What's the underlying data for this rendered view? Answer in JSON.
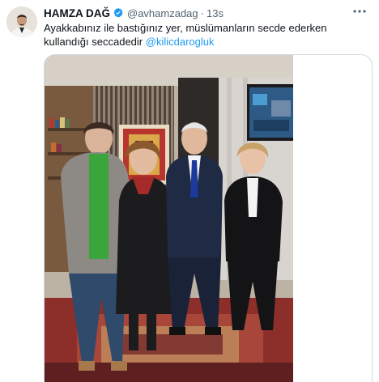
{
  "tweet": {
    "display_name": "HAMZA DAĞ",
    "handle": "@avhamzadag",
    "separator": "·",
    "time": "13s",
    "text_before": "Ayakkabınız ile bastığınız yer, müslümanların secde ederken kullandığı seccadedir ",
    "mention": "@kilicdarogluk"
  },
  "icons": {
    "verified": "verified-badge-icon",
    "more": "more-options-icon"
  },
  "colors": {
    "accent": "#1d9bf0",
    "text": "#0f1419",
    "secondary": "#536471",
    "border": "#cfd9de"
  }
}
